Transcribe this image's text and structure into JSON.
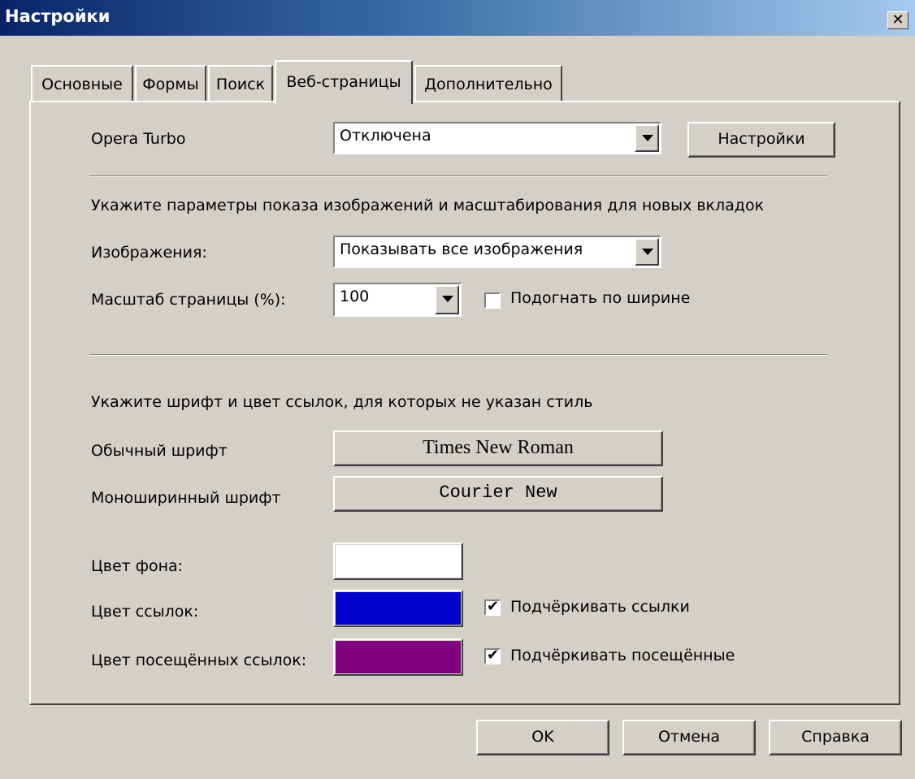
{
  "window": {
    "title": "Настройки",
    "close_glyph": "✕"
  },
  "tabs": [
    {
      "label": "Основные",
      "active": false
    },
    {
      "label": "Формы",
      "active": false
    },
    {
      "label": "Поиск",
      "active": false
    },
    {
      "label": "Веб-страницы",
      "active": true
    },
    {
      "label": "Дополнительно",
      "active": false
    }
  ],
  "turbo": {
    "label": "Opera Turbo",
    "value": "Отключена",
    "settings_button": "Настройки"
  },
  "images_section": {
    "heading": "Укажите параметры показа изображений и масштабирования для новых вкладок",
    "images_label": "Изображения:",
    "images_value": "Показывать все изображения",
    "zoom_label": "Масштаб страницы (%):",
    "zoom_value": "100",
    "fit_width_label": "Подогнать по ширине",
    "fit_width_checked": false
  },
  "fonts_section": {
    "heading": "Укажите шрифт и цвет ссылок, для которых не указан стиль",
    "normal_font_label": "Обычный шрифт",
    "normal_font_value": "Times New Roman",
    "mono_font_label": "Моноширинный шрифт",
    "mono_font_value": "Courier New",
    "bg_color_label": "Цвет фона:",
    "bg_color": "#ffffff",
    "link_color_label": "Цвет ссылок:",
    "link_color": "#0000cc",
    "underline_links_label": "Подчёркивать ссылки",
    "underline_links_checked": true,
    "visited_color_label": "Цвет посещённых ссылок:",
    "visited_color": "#800080",
    "underline_visited_label": "Подчёркивать посещённые",
    "underline_visited_checked": true
  },
  "footer": {
    "ok": "OK",
    "cancel": "Отмена",
    "help": "Справка"
  },
  "check_glyph": "✔"
}
